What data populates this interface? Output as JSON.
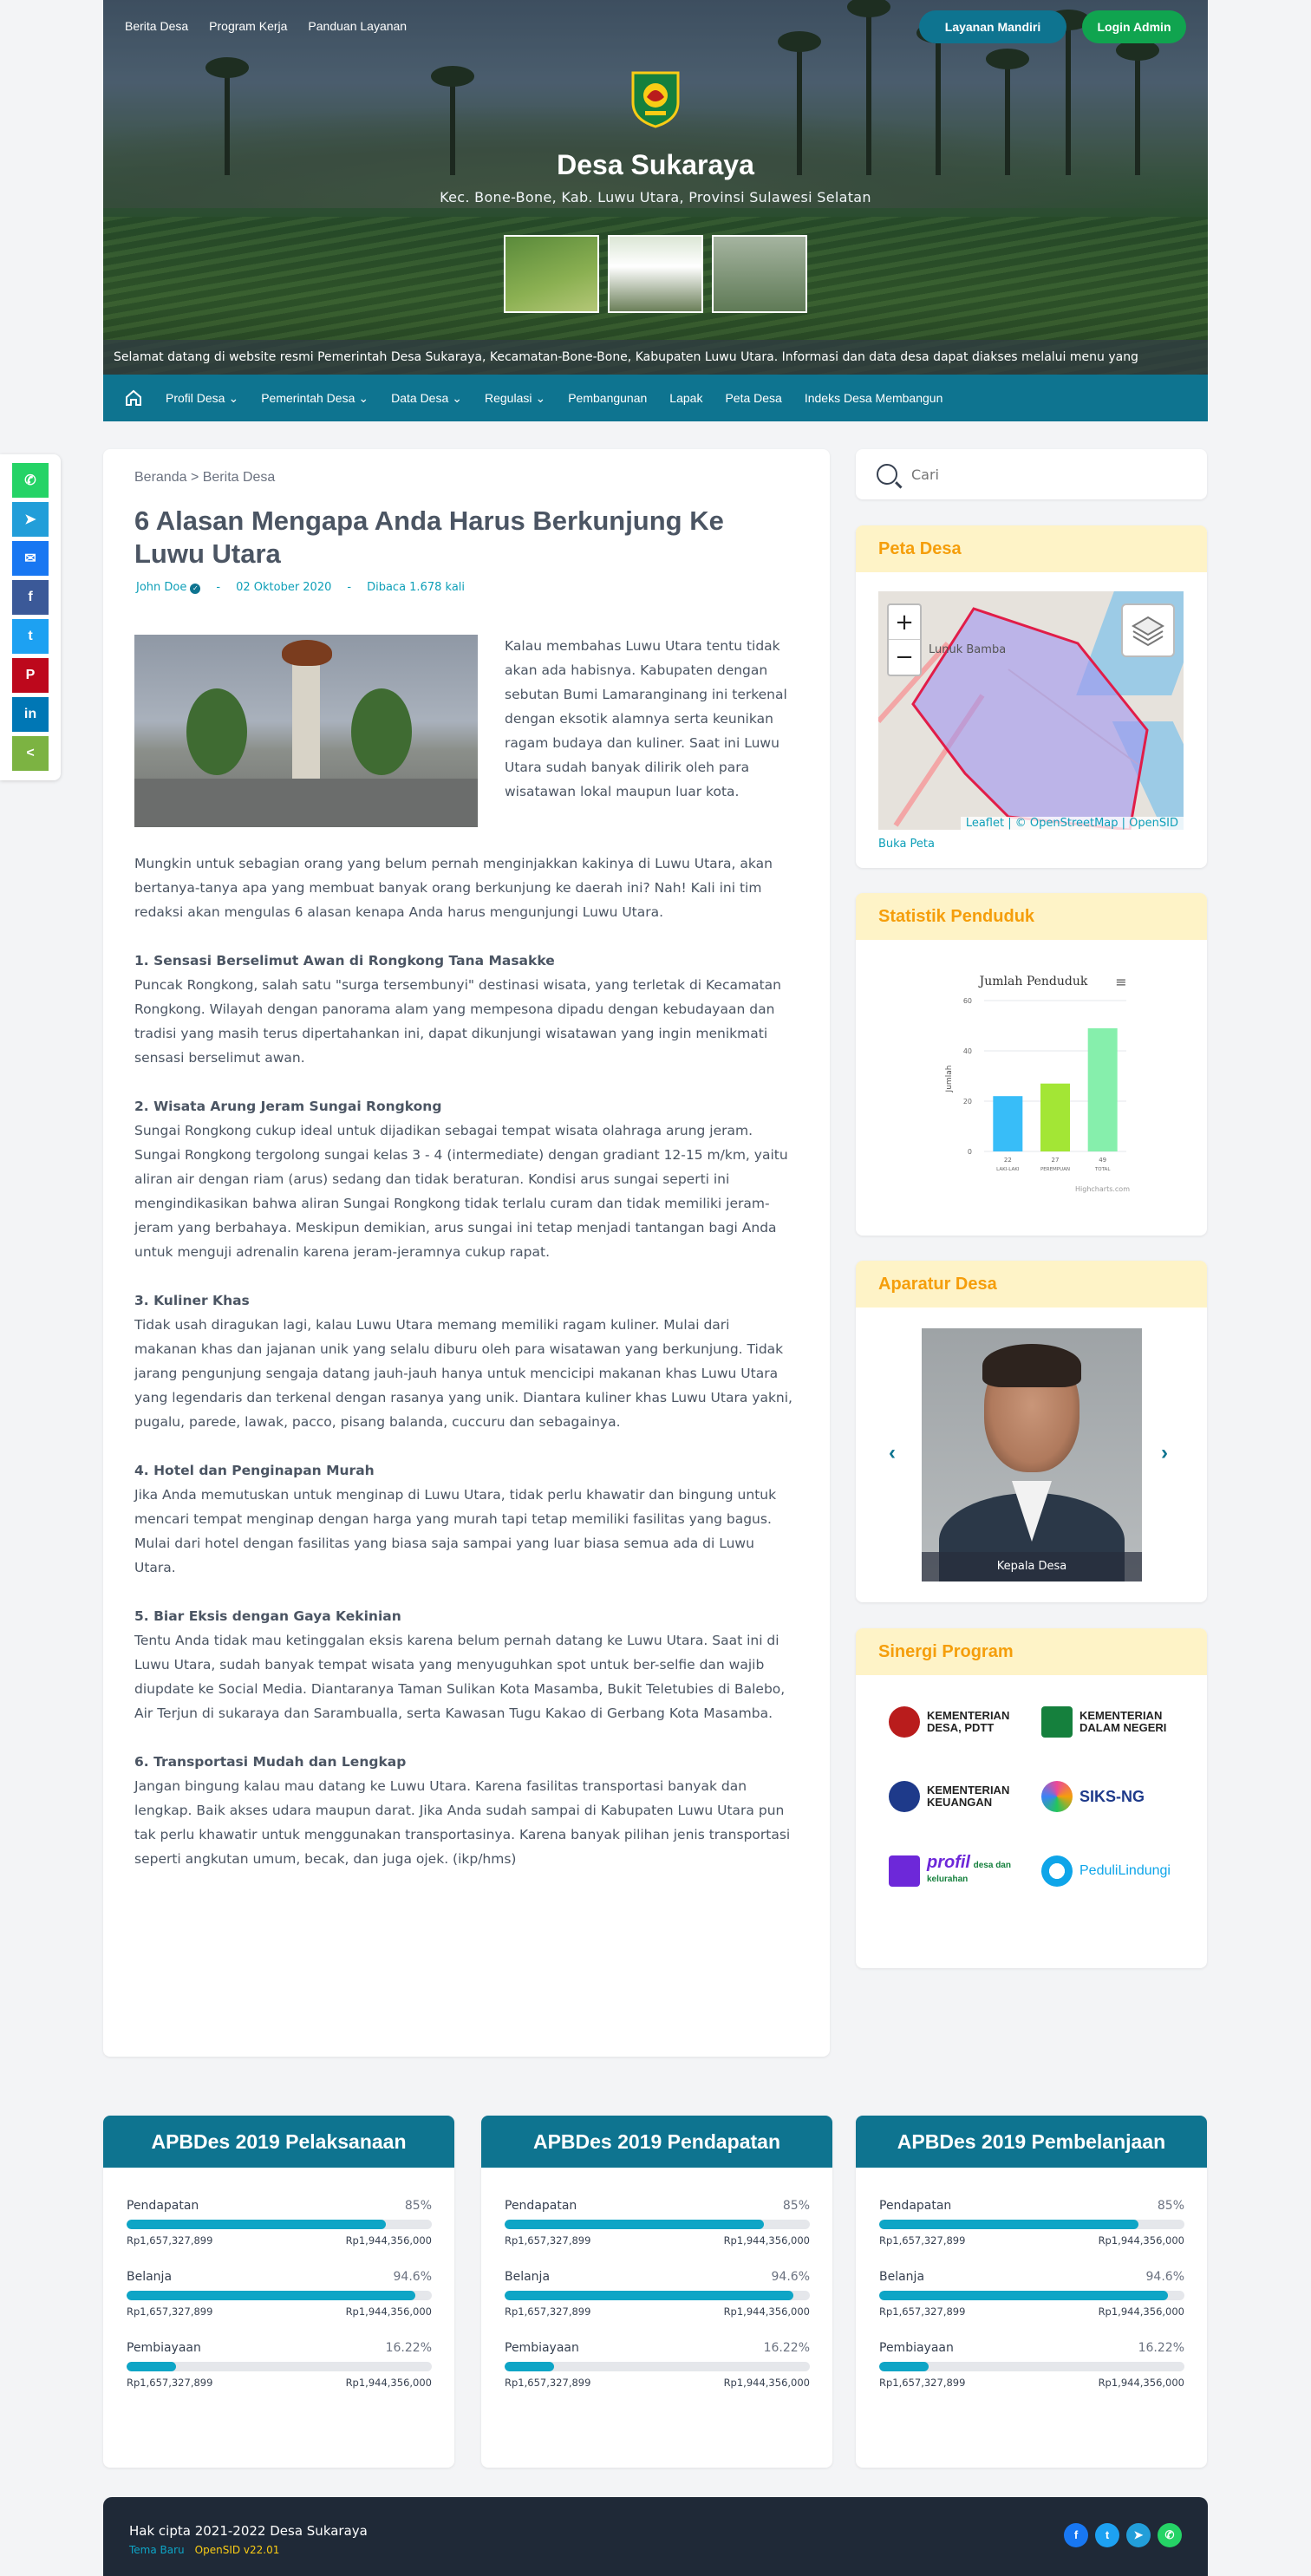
{
  "topnav": [
    "Berita Desa",
    "Program Kerja",
    "Panduan Layanan"
  ],
  "buttons": {
    "mandiri": "Layanan Mandiri",
    "admin": "Login Admin"
  },
  "site": {
    "title": "Desa Sukaraya",
    "subtitle": "Kec. Bone-Bone, Kab. Luwu Utara, Provinsi Sulawesi Selatan"
  },
  "ticker": "Selamat datang di website resmi Pemerintah Desa Sukaraya, Kecamatan-Bone-Bone, Kabupaten Luwu Utara. Informasi dan data desa dapat diakses melalui menu yang",
  "mainnav": [
    {
      "label": "Profil Desa",
      "caret": "⌄"
    },
    {
      "label": "Pemerintah Desa",
      "caret": "⌄"
    },
    {
      "label": "Data Desa",
      "caret": "⌄"
    },
    {
      "label": "Regulasi",
      "caret": "⌄"
    },
    {
      "label": "Pembangunan",
      "caret": ""
    },
    {
      "label": "Lapak",
      "caret": ""
    },
    {
      "label": "Peta Desa",
      "caret": ""
    },
    {
      "label": "Indeks Desa Membangun",
      "caret": ""
    }
  ],
  "share": [
    {
      "icon": "whatsapp-icon",
      "glyph": "✆",
      "color": "#25d366"
    },
    {
      "icon": "telegram-icon",
      "glyph": "➤",
      "color": "#229ed9"
    },
    {
      "icon": "messenger-icon",
      "glyph": "✉",
      "color": "#1877f2"
    },
    {
      "icon": "facebook-icon",
      "glyph": "f",
      "color": "#3b5998"
    },
    {
      "icon": "twitter-icon",
      "glyph": "t",
      "color": "#1da1f2"
    },
    {
      "icon": "pinterest-icon",
      "glyph": "P",
      "color": "#bd081c"
    },
    {
      "icon": "linkedin-icon",
      "glyph": "in",
      "color": "#0077b5"
    },
    {
      "icon": "share-icon",
      "glyph": "<",
      "color": "#7cb342"
    }
  ],
  "article": {
    "breadcrumb_home": "Beranda",
    "breadcrumb_sep": " > ",
    "breadcrumb_current": "Berita Desa",
    "title": "6 Alasan Mengapa Anda Harus Berkunjung Ke Luwu Utara",
    "author": "John Doe",
    "date": "02 Oktober 2020",
    "views": "Dibaca 1.678 kali",
    "lead": "Kalau membahas Luwu Utara tentu tidak akan ada habisnya. Kabupaten dengan sebutan Bumi Lamaranginang ini terkenal dengan eksotik alamnya serta keunikan ragam budaya dan kuliner. Saat ini Luwu Utara sudah banyak dilirik oleh para wisatawan lokal maupun luar kota.",
    "intro": "Mungkin untuk sebagian orang yang belum pernah menginjakkan kakinya di Luwu Utara, akan bertanya-tanya apa yang membuat banyak orang berkunjung ke daerah ini? Nah! Kali ini tim redaksi akan mengulas 6 alasan kenapa Anda harus mengunjungi Luwu Utara.",
    "sections": [
      {
        "heading": "1. Sensasi Berselimut Awan di Rongkong Tana Masakke",
        "text": "Puncak Rongkong, salah satu \"surga tersembunyi\" destinasi wisata, yang terletak di Kecamatan Rongkong. Wilayah dengan panorama alam yang mempesona dipadu dengan kebudayaan dan tradisi yang masih terus dipertahankan ini, dapat dikunjungi wisatawan yang ingin menikmati sensasi berselimut awan."
      },
      {
        "heading": "2. Wisata Arung Jeram Sungai Rongkong",
        "text": "Sungai Rongkong cukup ideal untuk dijadikan sebagai tempat wisata olahraga arung jeram. Sungai Rongkong tergolong sungai kelas 3 - 4 (intermediate) dengan gradiant 12-15 m/km, yaitu aliran air dengan riam (arus) sedang dan tidak beraturan. Kondisi arus sungai seperti ini mengindikasikan bahwa aliran Sungai Rongkong tidak terlalu curam dan tidak memiliki jeram-jeram yang berbahaya. Meskipun demikian, arus sungai ini tetap menjadi tantangan bagi Anda untuk menguji adrenalin karena jeram-jeramnya cukup rapat."
      },
      {
        "heading": "3. Kuliner Khas",
        "text": "Tidak usah diragukan lagi, kalau Luwu Utara memang memiliki ragam kuliner. Mulai dari makanan khas dan jajanan unik yang selalu diburu oleh para wisatawan yang berkunjung. Tidak jarang pengunjung sengaja datang jauh-jauh hanya untuk mencicipi makanan khas Luwu Utara yang legendaris dan terkenal dengan rasanya yang unik. Diantara kuliner khas Luwu Utara yakni, pugalu, parede, lawak, pacco, pisang balanda, cuccuru dan sebagainya."
      },
      {
        "heading": "4. Hotel dan Penginapan Murah",
        "text": "Jika Anda memutuskan untuk menginap di Luwu Utara, tidak perlu khawatir dan bingung untuk mencari tempat menginap dengan harga yang murah tapi tetap memiliki fasilitas yang bagus. Mulai dari hotel dengan fasilitas yang biasa saja sampai yang luar biasa semua ada di Luwu Utara."
      },
      {
        "heading": "5. Biar Eksis dengan Gaya Kekinian",
        "text": "Tentu Anda tidak mau ketinggalan eksis karena belum pernah datang ke Luwu Utara. Saat ini di Luwu Utara, sudah banyak tempat wisata yang menyuguhkan spot untuk ber-selfie dan wajib diupdate ke Social Media. Diantaranya Taman Sulikan Kota Masamba, Bukit Teletubies di Balebo, Air Terjun di sukaraya dan Sarambualla, serta Kawasan Tugu Kakao di Gerbang Kota Masamba."
      },
      {
        "heading": "6. Transportasi Mudah dan Lengkap",
        "text": "Jangan bingung kalau mau datang ke Luwu Utara. Karena fasilitas transportasi banyak dan lengkap. Baik akses udara maupun darat. Jika Anda sudah sampai di Kabupaten Luwu Utara pun tak perlu khawatir untuk menggunakan transportasinya. Karena banyak pilihan jenis transportasi seperti angkutan umum, becak, dan juga ojek. (ikp/hms)"
      }
    ]
  },
  "search": {
    "placeholder": "Cari"
  },
  "peta": {
    "title": "Peta Desa",
    "label": "Lunuk Bamba",
    "attribution": "Leaflet | © OpenStreetMap | OpenSID",
    "link": "Buka Peta",
    "zoom_in": "+",
    "zoom_out": "−"
  },
  "statistik": {
    "title": "Statistik Penduduk"
  },
  "chart_data": {
    "type": "bar",
    "title": "Jumlah Penduduk",
    "ylabel": "Jumlah",
    "categories": [
      "LAKI-LAKI",
      "PEREMPUAN",
      "TOTAL"
    ],
    "values": [
      22,
      27,
      49
    ],
    "ylim": [
      0,
      60
    ],
    "yticks": [
      0,
      20,
      40,
      60
    ],
    "colors": [
      "#38bdf8",
      "#a3e635",
      "#86efac"
    ],
    "credit": "Highcharts.com",
    "menu_glyph": "≡"
  },
  "aparatur": {
    "title": "Aparatur Desa",
    "caption": "Kepala Desa",
    "prev": "‹",
    "next": "›"
  },
  "sinergi": {
    "title": "Sinergi Program",
    "logos": [
      {
        "name": "KEMENTERIAN DESA, PDTT",
        "line1": "KEMENTERIAN",
        "line2": "DESA, PDTT",
        "color": "#b91c1c",
        "icon": "kemendesa-logo"
      },
      {
        "name": "KEMENTERIAN DALAM NEGERI",
        "line1": "KEMENTERIAN",
        "line2": "DALAM NEGERI",
        "color": "#15803d",
        "icon": "kemendagri-logo"
      },
      {
        "name": "KEMENTERIAN KEUANGAN",
        "line1": "KEMENTERIAN",
        "line2": "KEUANGAN",
        "color": "#1e3a8a",
        "icon": "kemenkeu-logo"
      },
      {
        "name": "SIKS-NG",
        "line1": "SIKS-NG",
        "line2": "",
        "color": "#ec4899",
        "icon": "siksng-logo"
      },
      {
        "name": "profil desa dan kelurahan",
        "line1": "profil",
        "line2": "desa dan kelurahan",
        "color": "#6d28d9",
        "icon": "prodeskel-logo"
      },
      {
        "name": "PeduliLindungi",
        "line1": "PeduliLindungi",
        "line2": "",
        "color": "#0ea5e9",
        "icon": "pedulilindungi-logo"
      }
    ]
  },
  "apbdes": [
    {
      "title": "APBDes 2019 Pelaksanaan",
      "rows": [
        {
          "label": "Pendapatan",
          "percent": "85%",
          "fraction": 0.85,
          "real": "Rp1,657,327,899",
          "budget": "Rp1,944,356,000"
        },
        {
          "label": "Belanja",
          "percent": "94.6%",
          "fraction": 0.946,
          "real": "Rp1,657,327,899",
          "budget": "Rp1,944,356,000"
        },
        {
          "label": "Pembiayaan",
          "percent": "16.22%",
          "fraction": 0.1622,
          "real": "Rp1,657,327,899",
          "budget": "Rp1,944,356,000"
        }
      ]
    },
    {
      "title": "APBDes 2019 Pendapatan",
      "rows": [
        {
          "label": "Pendapatan",
          "percent": "85%",
          "fraction": 0.85,
          "real": "Rp1,657,327,899",
          "budget": "Rp1,944,356,000"
        },
        {
          "label": "Belanja",
          "percent": "94.6%",
          "fraction": 0.946,
          "real": "Rp1,657,327,899",
          "budget": "Rp1,944,356,000"
        },
        {
          "label": "Pembiayaan",
          "percent": "16.22%",
          "fraction": 0.1622,
          "real": "Rp1,657,327,899",
          "budget": "Rp1,944,356,000"
        }
      ]
    },
    {
      "title": "APBDes 2019 Pembelanjaan",
      "rows": [
        {
          "label": "Pendapatan",
          "percent": "85%",
          "fraction": 0.85,
          "real": "Rp1,657,327,899",
          "budget": "Rp1,944,356,000"
        },
        {
          "label": "Belanja",
          "percent": "94.6%",
          "fraction": 0.946,
          "real": "Rp1,657,327,899",
          "budget": "Rp1,944,356,000"
        },
        {
          "label": "Pembiayaan",
          "percent": "16.22%",
          "fraction": 0.1622,
          "real": "Rp1,657,327,899",
          "budget": "Rp1,944,356,000"
        }
      ]
    }
  ],
  "footer": {
    "copyright": "Hak cipta 2021-2022 Desa Sukaraya",
    "theme": "Tema Baru",
    "version": "OpenSID v22.01",
    "social": [
      {
        "icon": "facebook-icon",
        "glyph": "f",
        "color": "#1877f2"
      },
      {
        "icon": "twitter-icon",
        "glyph": "t",
        "color": "#1da1f2"
      },
      {
        "icon": "telegram-icon",
        "glyph": "➤",
        "color": "#229ed9"
      },
      {
        "icon": "whatsapp-icon",
        "glyph": "✆",
        "color": "#25d366"
      }
    ]
  }
}
